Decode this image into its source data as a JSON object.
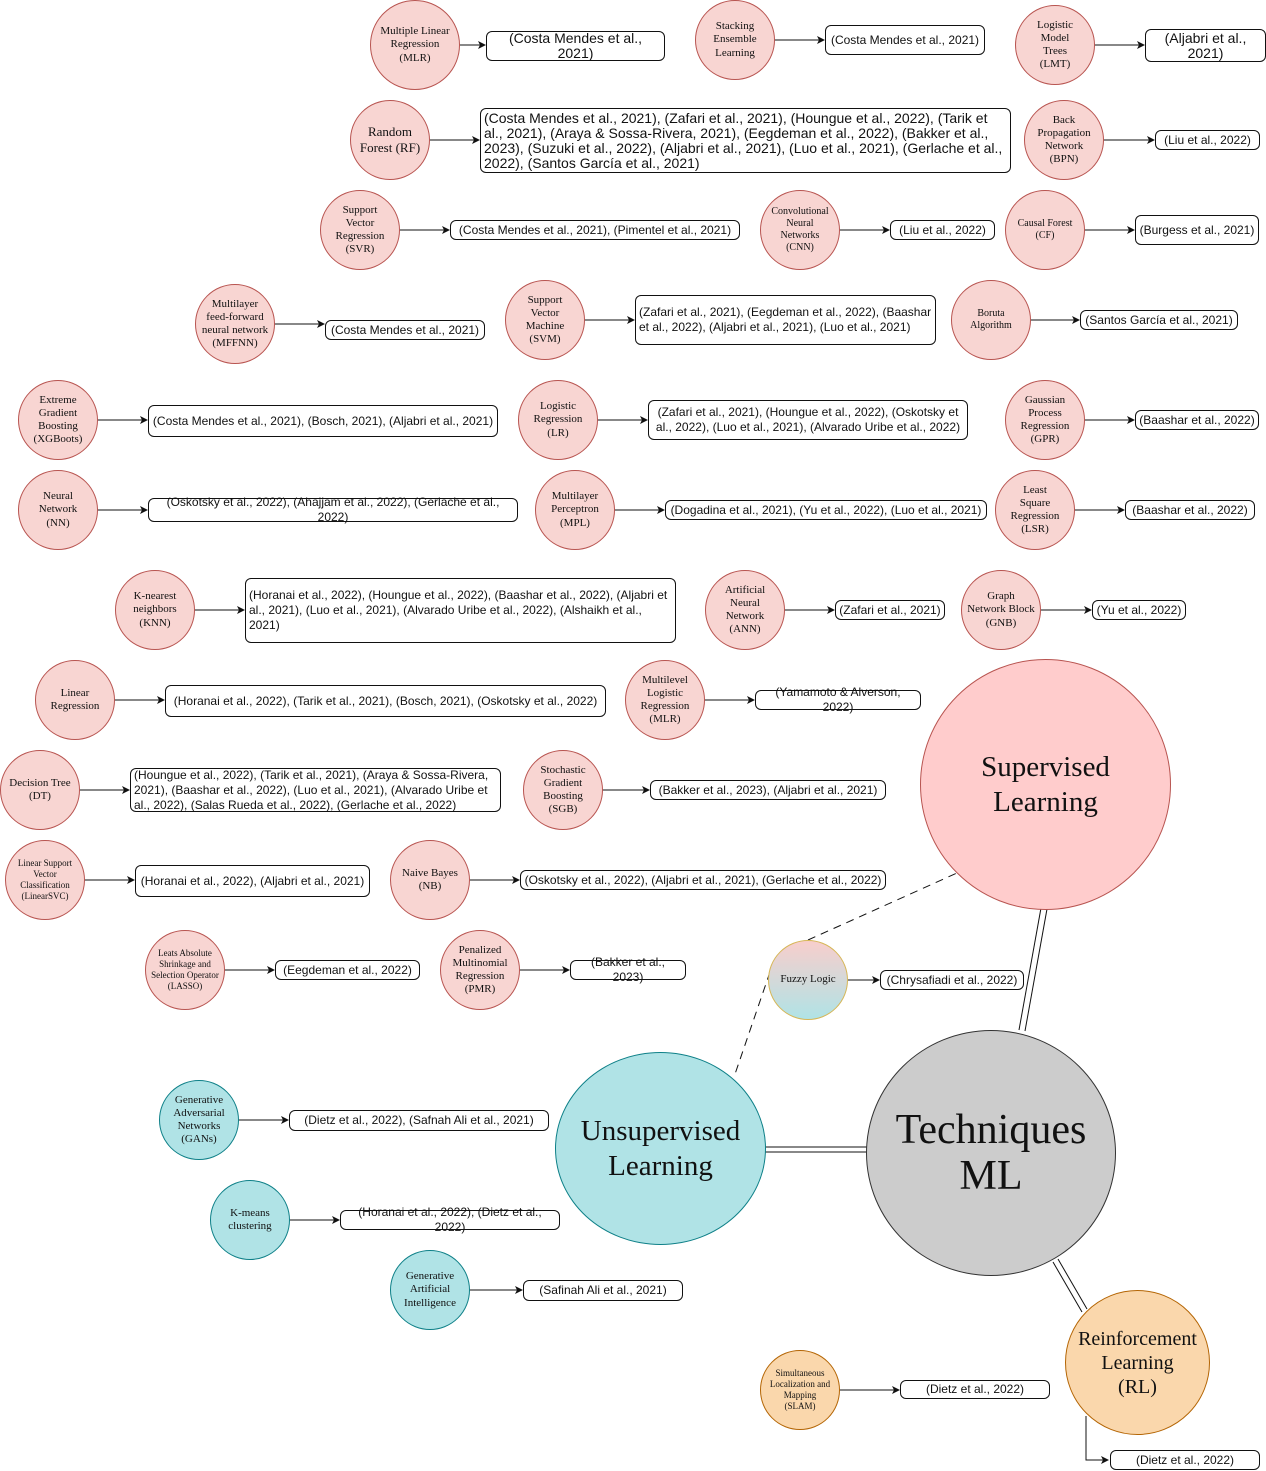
{
  "hubs": {
    "main": "Techniques\nML",
    "supervised": "Supervised\nLearning",
    "unsupervised": "Unsupervised\nLearning",
    "reinforcement": "Reinforcement\nLearning\n(RL)",
    "fuzzy": "Fuzzy Logic"
  },
  "supervised_techniques": [
    {
      "id": "mlr1",
      "label": "Multiple Linear\nRegression\n(MLR)",
      "citations": "(Costa Mendes et al., 2021)"
    },
    {
      "id": "stack",
      "label": "Stacking\nEnsemble\nLearning",
      "citations": "(Costa Mendes et al., 2021)"
    },
    {
      "id": "lmt",
      "label": "Logistic\nModel\nTrees\n(LMT)",
      "citations": "(Aljabri et al.,\n2021)"
    },
    {
      "id": "rf",
      "label": "Random\nForest (RF)",
      "citations": "(Costa Mendes et al., 2021), (Zafari et al., 2021), (Houngue et al., 2022), (Tarik et al., 2021), (Araya & Sossa-Rivera, 2021), (Eegdeman et al., 2022), (Bakker et al., 2023), (Suzuki et al., 2022), (Aljabri et al., 2021), (Luo et al., 2021), (Gerlache et al., 2022), (Santos García et al., 2021)"
    },
    {
      "id": "bpn",
      "label": "Back\nPropagation\nNetwork\n(BPN)",
      "citations": "(Liu et al., 2022)"
    },
    {
      "id": "svr",
      "label": "Support\nVector\nRegression\n(SVR)",
      "citations": "(Costa Mendes et al., 2021), (Pimentel et al., 2021)"
    },
    {
      "id": "cnn",
      "label": "Convolutional\nNeural\nNetworks\n(CNN)",
      "citations": "(Liu et al., 2022)"
    },
    {
      "id": "cf",
      "label": "Causal Forest\n(CF)",
      "citations": "(Burgess et al., 2021)"
    },
    {
      "id": "mffnn",
      "label": "Multilayer\nfeed-forward\nneural network\n(MFFNN)",
      "citations": "(Costa Mendes et al., 2021)"
    },
    {
      "id": "svm",
      "label": "Support\nVector\nMachine\n(SVM)",
      "citations": "(Zafari et al., 2021), (Eegdeman et al., 2022), (Baashar et al., 2022), (Aljabri et al., 2021), (Luo et al., 2021)"
    },
    {
      "id": "boruta",
      "label": "Boruta\nAlgorithm",
      "citations": "(Santos García et al., 2021)"
    },
    {
      "id": "xgb",
      "label": "Extreme\nGradient\nBoosting\n(XGBoots)",
      "citations": "(Costa Mendes et al., 2021), (Bosch, 2021), (Aljabri et al., 2021)"
    },
    {
      "id": "lr",
      "label": "Logistic\nRegression\n(LR)",
      "citations": "(Zafari et al., 2021), (Houngue et al., 2022), (Oskotsky et al., 2022), (Luo et al., 2021), (Alvarado Uribe et al., 2022)"
    },
    {
      "id": "gpr",
      "label": "Gaussian\nProcess\nRegression\n(GPR)",
      "citations": "(Baashar et al., 2022)"
    },
    {
      "id": "nn",
      "label": "Neural\nNetwork\n(NN)",
      "citations": "(Oskotsky et al., 2022), (Ahajjam et al., 2022), (Gerlache et al., 2022)"
    },
    {
      "id": "mpl",
      "label": "Multilayer\nPerceptron\n(MPL)",
      "citations": "(Dogadina et al., 2021), (Yu et al., 2022), (Luo et al., 2021)"
    },
    {
      "id": "lsr",
      "label": "Least\nSquare\nRegression\n(LSR)",
      "citations": "(Baashar et al., 2022)"
    },
    {
      "id": "knn",
      "label": "K-nearest\nneighbors\n(KNN)",
      "citations": "(Horanai et al., 2022), (Houngue et al., 2022), (Baashar et al., 2022), (Aljabri et al., 2021), (Luo et al., 2021), (Alvarado Uribe et al., 2022), (Alshaikh et al., 2021)"
    },
    {
      "id": "ann",
      "label": "Artificial\nNeural\nNetwork\n(ANN)",
      "citations": "(Zafari et al., 2021)"
    },
    {
      "id": "gnb",
      "label": "Graph\nNetwork Block\n(GNB)",
      "citations": "(Yu et al., 2022)"
    },
    {
      "id": "linreg",
      "label": "Linear\nRegression",
      "citations": "(Horanai et al., 2022), (Tarik et al., 2021), (Bosch, 2021), (Oskotsky et al., 2022)"
    },
    {
      "id": "mlr2",
      "label": "Multilevel\nLogistic\nRegression\n(MLR)",
      "citations": "(Yamamoto & Alverson, 2022)"
    },
    {
      "id": "dt",
      "label": "Decision Tree\n(DT)",
      "citations": "(Houngue et al., 2022), (Tarik et al., 2021), (Araya & Sossa-Rivera, 2021), (Baashar et al., 2022), (Luo et al., 2021), (Alvarado Uribe et al., 2022), (Salas Rueda et al., 2022), (Gerlache et al., 2022)"
    },
    {
      "id": "sgb",
      "label": "Stochastic\nGradient\nBoosting\n(SGB)",
      "citations": "(Bakker et al., 2023), (Aljabri et al., 2021)"
    },
    {
      "id": "lsvc",
      "label": "Linear Support\nVector\nClassification\n(LinearSVC)",
      "citations": "(Horanai et al., 2022), (Aljabri et al., 2021)"
    },
    {
      "id": "nb",
      "label": "Naive Bayes\n(NB)",
      "citations": "(Oskotsky et al., 2022), (Aljabri et al., 2021), (Gerlache et al., 2022)"
    },
    {
      "id": "lasso",
      "label": "Leats Absolute\nShrinkage and\nSelection Operator\n(LASSO)",
      "citations": "(Eegdeman et al., 2022)"
    },
    {
      "id": "pmr",
      "label": "Penalized\nMultinomial\nRegression\n(PMR)",
      "citations": "(Bakker et al., 2023)"
    }
  ],
  "fuzzy_citation": "(Chrysafiadi et al., 2022)",
  "unsupervised_techniques": [
    {
      "id": "gan",
      "label": "Generative\nAdversarial\nNetworks\n(GANs)",
      "citations": "(Dietz et al., 2022), (Safnah Ali et al., 2021)"
    },
    {
      "id": "kmeans",
      "label": "K-means\nclustering",
      "citations": "(Horanai et al., 2022), (Dietz et al., 2022)"
    },
    {
      "id": "genai",
      "label": "Generative\nArtificial\nIntelligence",
      "citations": "(Safinah Ali et al., 2021)"
    }
  ],
  "reinforcement_techniques": [
    {
      "id": "slam",
      "label": "Simultaneous\nLocalization and\nMapping\n(SLAM)",
      "citations": "(Dietz et al., 2022)"
    }
  ],
  "rl_citation": "(Dietz et al., 2022)",
  "colors": {
    "supervised_fill": "#f8d5d2",
    "supervised_stroke": "#b85450",
    "unsupervised_fill": "#b0e3e6",
    "unsupervised_stroke": "#0e8088",
    "reinforcement_fill": "#fad7ac",
    "reinforcement_stroke": "#b46504",
    "main_fill": "#cccccc"
  }
}
